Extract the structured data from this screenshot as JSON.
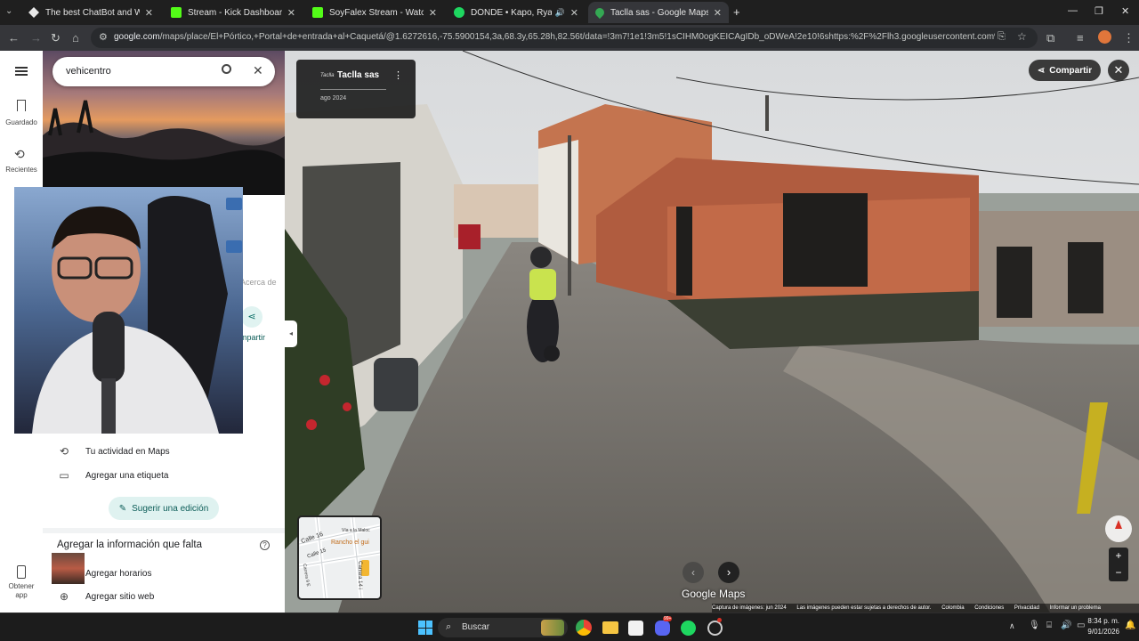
{
  "browser": {
    "tabs": [
      {
        "title": "The best ChatBot and Widgets",
        "favicon": "streamelements-icon",
        "color": "#cccccc"
      },
      {
        "title": "Stream - Kick Dashboard",
        "favicon": "kick-icon",
        "color": "#53fc18"
      },
      {
        "title": "SoyFalex Stream - Watch Live o",
        "favicon": "kick-icon",
        "color": "#53fc18"
      },
      {
        "title": "DÓNDE • Kapo, Ryan Castr",
        "favicon": "spotify-icon",
        "color": "#1ed760"
      },
      {
        "title": "Taclla sas - Google Maps",
        "favicon": "google-maps-icon",
        "color": "#34a853",
        "active": true
      }
    ],
    "url_host": "google.com",
    "url_path": "/maps/place/El+Pórtico,+Portal+de+entrada+al+Caquetá/@1.6272616,-75.5900154,3a,68.3y,65.28h,82.56t/data=!3m7!1e1!3m5!1sCIHM0ogKEICAgIDb_oDWeA!2e10!6shttps:%2F%2Flh3.googleusercontent.com%2Fgpms-cs-s%..."
  },
  "maps": {
    "rail": {
      "saved_label": "Guardado",
      "recents_label": "Recientes",
      "get_app_label": "Obtener app"
    },
    "search": {
      "value": "vehicentro"
    },
    "panel": {
      "partial_about_tab": "Acerca de",
      "partial_share": "mpartir",
      "activity_label": "Tu actividad en Maps",
      "add_label_label": "Agregar una etiqueta",
      "suggest_edit_label": "Sugerir una edición",
      "missing_info_title": "Agregar la información que falta",
      "add_hours_label": "Agregar horarios",
      "add_website_label": "Agregar sitio web"
    }
  },
  "street_view": {
    "place_name": "Taclla sas",
    "logo_text": "Taclla",
    "date": "ago 2024",
    "share_label": "Compartir",
    "watermark": "Google Maps",
    "minimap_labels": [
      "Calle 16",
      "Calle 15",
      "Vía a la Maloc",
      "Rancho el gui",
      "Carrera 14 i",
      "Carrera 9 E"
    ],
    "footer": [
      "Captura de imágenes: jun 2024",
      "Las imágenes pueden estar sujetas a derechos de autor.",
      "Colombia",
      "Condiciones",
      "Privacidad",
      "Informar un problema"
    ]
  },
  "taskbar": {
    "search_label": "Buscar",
    "discord_badge": "99+",
    "time": "8:34 p. m.",
    "date": "9/01/2026"
  }
}
